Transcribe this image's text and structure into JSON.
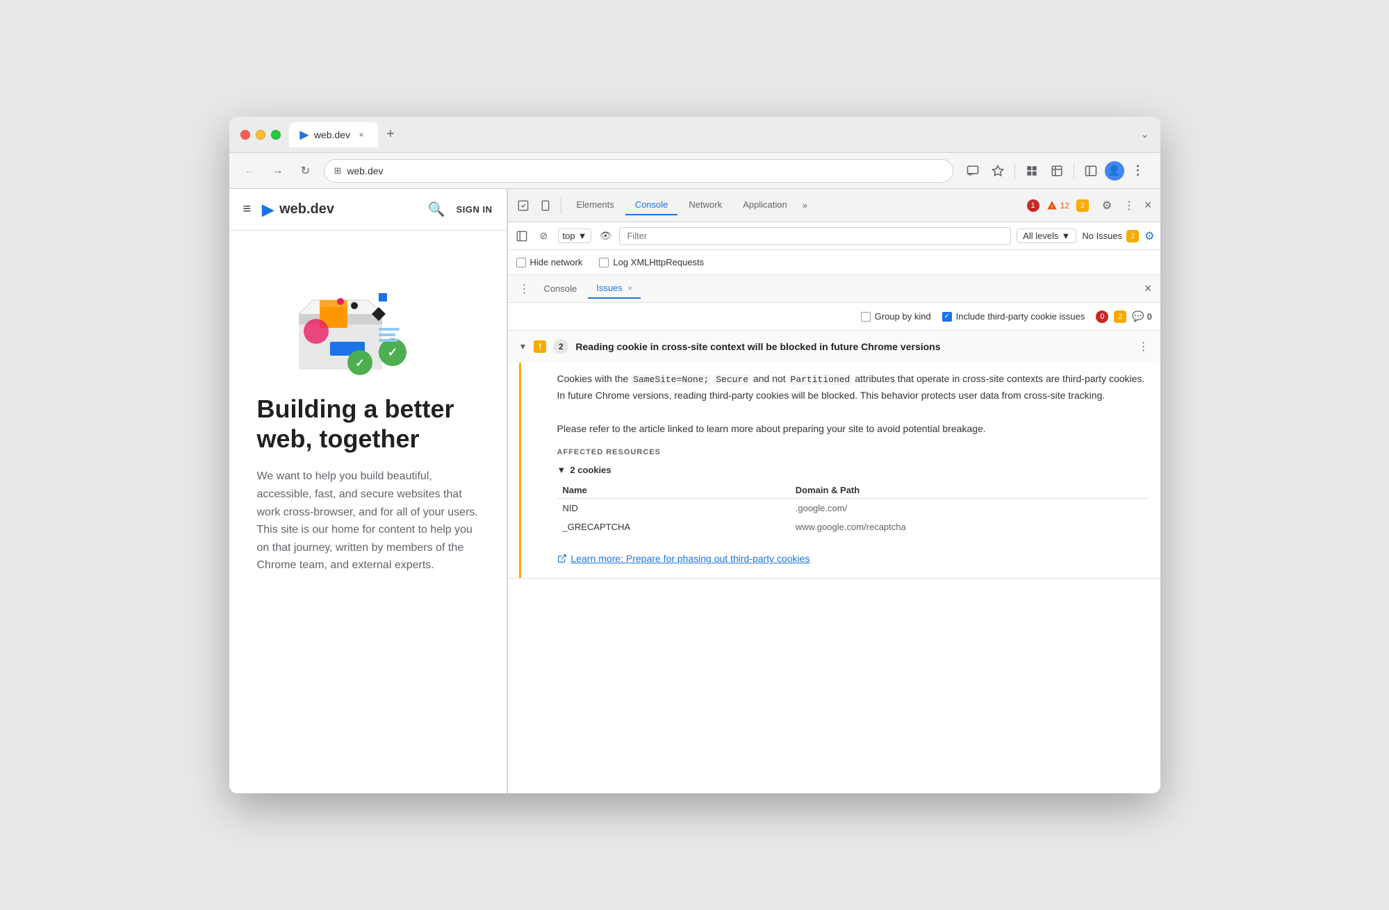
{
  "browser": {
    "tab_favicon": "▶",
    "tab_title": "web.dev",
    "tab_close": "×",
    "tab_new": "+",
    "window_control_chevron": "⌄",
    "nav": {
      "back": "←",
      "forward": "→",
      "reload": "↻",
      "address_icon": "⊞",
      "address_url": "web.dev",
      "cast_icon": "⎚",
      "bookmark_icon": "☆",
      "extension_icon": "⬛",
      "extension2_icon": "⚡",
      "toggle_icon": "⊟",
      "profile_icon": "👤",
      "menu_icon": "⋮"
    }
  },
  "website": {
    "hamburger": "≡",
    "logo_icon": "▶",
    "logo_text": "web.dev",
    "search_icon": "🔍",
    "signin": "SIGN IN",
    "hero_title": "Building a better web, together",
    "hero_desc": "We want to help you build beautiful, accessible, fast, and secure websites that work cross-browser, and for all of your users. This site is our home for content to help you on that journey, written by members of the Chrome team, and external experts."
  },
  "devtools": {
    "topbar": {
      "inspect_icon": "⊹",
      "device_icon": "⊡",
      "tabs": [
        "Elements",
        "Console",
        "Network",
        "Application"
      ],
      "active_tab": "Console",
      "more_tabs": "»",
      "badge_red_count": "1",
      "badge_orange_count": "12",
      "badge_yellow_count": "2",
      "settings_icon": "⚙",
      "more_icon": "⋮",
      "close_icon": "×"
    },
    "console_toolbar": {
      "clear_icon": "⊘",
      "sidebar_icon": "⊟",
      "context_label": "top",
      "context_arrow": "▼",
      "eye_icon": "👁",
      "filter_placeholder": "Filter",
      "levels_label": "All levels",
      "levels_arrow": "▼",
      "no_issues_label": "No Issues",
      "issues_count": "2",
      "gear_icon": "⚙"
    },
    "checkbox_row": {
      "hide_network": "Hide network",
      "log_xml": "Log XMLHttpRequests"
    },
    "subtabs": {
      "console": "Console",
      "issues": "Issues",
      "close": "×",
      "options_icon": "⋮",
      "close_right": "×"
    },
    "issues_options": {
      "group_by_kind": "Group by kind",
      "include_third_party": "Include third-party cookie issues",
      "badge_red": "0",
      "badge_orange": "2",
      "badge_chat": "0"
    },
    "issue": {
      "chevron": "▼",
      "warning_icon": "⚠",
      "count": "2",
      "title": "Reading cookie in cross-site context will be blocked in future Chrome versions",
      "menu_icon": "⋮",
      "desc1": "Cookies with the ",
      "code1": "SameSite=None;",
      "desc2": " ",
      "code2": "Secure",
      "desc3": " and not ",
      "code3": "Partitioned",
      "desc4": " attributes that operate in cross-site contexts are third-party cookies. In future Chrome versions, reading third-party cookies will be blocked. This behavior protects user data from cross-site tracking.",
      "desc_p2": "Please refer to the article linked to learn more about preparing your site to avoid potential breakage.",
      "affected_resources_label": "AFFECTED RESOURCES",
      "cookies_chevron": "▼",
      "cookies_count_label": "2 cookies",
      "col_name": "Name",
      "col_domain": "Domain & Path",
      "cookie1_name": "NID",
      "cookie1_domain": ".google.com/",
      "cookie2_name": "_GRECAPTCHA",
      "cookie2_domain": "www.google.com/recaptcha",
      "learn_more_icon": "⬡",
      "learn_more_text": "Learn more: Prepare for phasing out third-party cookies"
    }
  }
}
